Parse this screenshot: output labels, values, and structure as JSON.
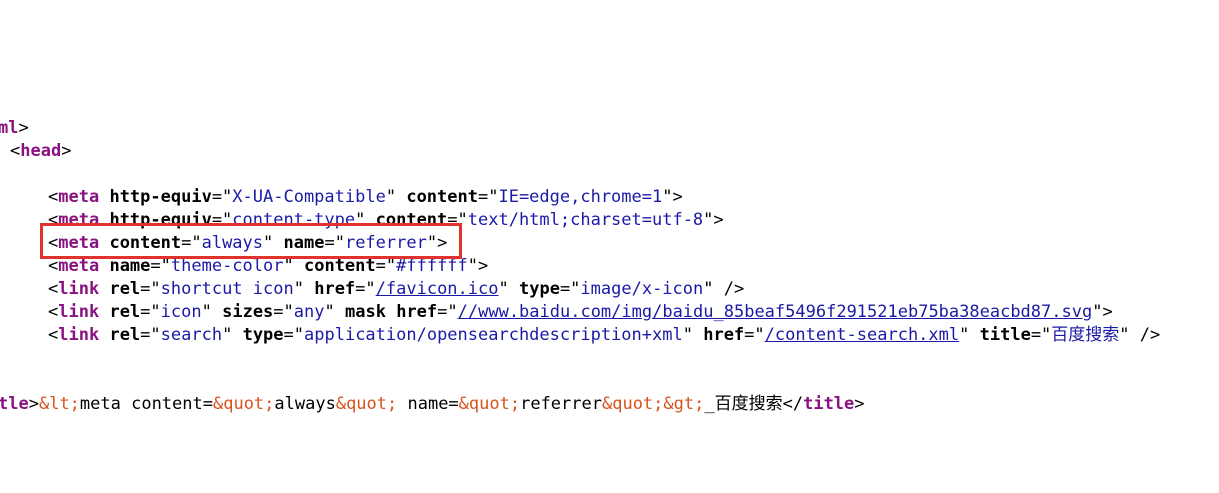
{
  "source_lines": {
    "line1": {
      "tag_fragment": "ml",
      "close": ">"
    },
    "line2": {
      "open": "<",
      "tag": "head",
      "close": ">"
    },
    "line3": {
      "open": "<",
      "tag": "meta",
      "a1": "http-equiv",
      "eq1": "=\"",
      "v1": "X-UA-Compatible",
      "q1": "\"",
      "a2": "content",
      "eq2": "=\"",
      "v2": "IE=edge,chrome=1",
      "q2": "\"",
      "close": ">"
    },
    "line4": {
      "open": "<",
      "tag": "meta",
      "a1": "http-equiv",
      "eq1": "=\"",
      "v1": "content-type",
      "q1": "\"",
      "a2": "content",
      "eq2": "=\"",
      "v2": "text/html;charset=utf-8",
      "q2": "\"",
      "close": ">"
    },
    "line5": {
      "open": "<",
      "tag": "meta",
      "a1": "content",
      "eq1": "=\"",
      "v1": "always",
      "q1": "\"",
      "a2": "name",
      "eq2": "=\"",
      "v2": "referrer",
      "q2": "\"",
      "close": ">"
    },
    "line6": {
      "open": "<",
      "tag": "meta",
      "a1": "name",
      "eq1": "=\"",
      "v1": "theme-color",
      "q1": "\"",
      "a2": "content",
      "eq2": "=\"",
      "v2": "#ffffff",
      "q2": "\"",
      "close": ">"
    },
    "line7": {
      "open": "<",
      "tag": "link",
      "a1": "rel",
      "eq1": "=\"",
      "v1": "shortcut icon",
      "q1": "\"",
      "a2": "href",
      "eq2": "=\"",
      "v2": "/favicon.ico",
      "q2": "\"",
      "a3": "type",
      "eq3": "=\"",
      "v3": "image/x-icon",
      "q3": "\"",
      "close": " />"
    },
    "line8": {
      "open": "<",
      "tag": "link",
      "a1": "rel",
      "eq1": "=\"",
      "v1": "icon",
      "q1": "\"",
      "a2": "sizes",
      "eq2": "=\"",
      "v2": "any",
      "q2": "\"",
      "a3": "mask",
      "a4": "href",
      "eq4": "=\"",
      "v4": "//www.baidu.com/img/baidu_85beaf5496f291521eb75ba38eacbd87.svg",
      "q4": "\"",
      "close": ">"
    },
    "line9": {
      "open": "<",
      "tag": "link",
      "a1": "rel",
      "eq1": "=\"",
      "v1": "search",
      "q1": "\"",
      "a2": "type",
      "eq2": "=\"",
      "v2": "application/opensearchdescription+xml",
      "q2": "\"",
      "a3": "href",
      "eq3": "=\"",
      "v3": "/content-search.xml",
      "q3": "\"",
      "a4": "title",
      "eq4": "=\"",
      "v4": "百度搜索",
      "q4": "\"",
      "close": " />"
    },
    "line10": {
      "tag_fragment": "tle",
      "gt": ">",
      "e1": "&lt;",
      "t1": "meta content=",
      "e2": "&quot;",
      "t2": "always",
      "e3": "&quot;",
      "t3": " name=",
      "e4": "&quot;",
      "t4": "referrer",
      "e5": "&quot;",
      "e6": "&gt;",
      "t5": "_百度搜索",
      "close_open": "</",
      "close_tag": "title",
      "close_gt": ">"
    }
  },
  "highlight": {
    "color": "#e0332d"
  }
}
